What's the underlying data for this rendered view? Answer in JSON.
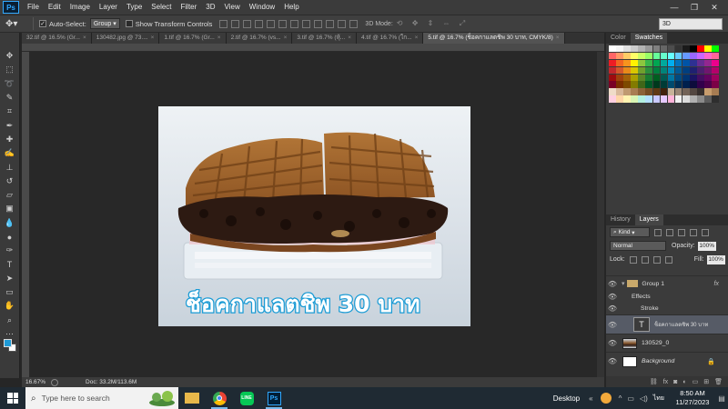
{
  "app": {
    "logo": "Ps",
    "menu": [
      "File",
      "Edit",
      "Image",
      "Layer",
      "Type",
      "Select",
      "Filter",
      "3D",
      "View",
      "Window",
      "Help"
    ],
    "window_controls": [
      "—",
      "❐",
      "✕"
    ]
  },
  "options_bar": {
    "auto_select_label": "Auto-Select:",
    "auto_select_value": "Group",
    "show_transform_label": "Show Transform Controls",
    "mode_3d_label": "3D Mode:",
    "workspace_value": "3D"
  },
  "tabs": [
    {
      "label": "32.tif @ 16.5% (Gr...",
      "active": false
    },
    {
      "label": "130482.jpg @ 73....",
      "active": false
    },
    {
      "label": "1.tif @ 16.7% (Gr...",
      "active": false
    },
    {
      "label": "2.tif @ 16.7% (vs...",
      "active": false
    },
    {
      "label": "3.tif @ 16.7% (หุ้...",
      "active": false
    },
    {
      "label": "4.tif @ 16.7% (ใก...",
      "active": false
    },
    {
      "label": "5.tif @ 16.7% (ช็อคกาแลตชิพ 30 บาท, CMYK/8)",
      "active": true
    }
  ],
  "canvas": {
    "caption": "ช็อคกาแลตชิพ 30 บาท"
  },
  "status": {
    "zoom": "16.67%",
    "doc": "Doc: 33.2M/113.6M"
  },
  "panels": {
    "top_tabs": [
      "Color",
      "Swatches"
    ],
    "top_active": "Swatches",
    "swatch_colors": [
      "#ffffff",
      "#f5f5f5",
      "#e0e0e0",
      "#cccccc",
      "#b3b3b3",
      "#999999",
      "#808080",
      "#666666",
      "#4d4d4d",
      "#333333",
      "#1a1a1a",
      "#000000",
      "#ff0000",
      "#ffff00",
      "#00ff00",
      "#ff6666",
      "#ff9966",
      "#ffcc66",
      "#ffff66",
      "#ccff66",
      "#99ff66",
      "#66ff99",
      "#66ffcc",
      "#66ffff",
      "#66ccff",
      "#6699ff",
      "#9966ff",
      "#cc66ff",
      "#ff66cc",
      "#ff6699",
      "#ee1c24",
      "#f26522",
      "#f7941d",
      "#fff200",
      "#8dc63f",
      "#39b54a",
      "#00a651",
      "#00a99d",
      "#00aeef",
      "#0072bc",
      "#0054a6",
      "#2e3192",
      "#662d91",
      "#92278f",
      "#ec008c",
      "#c1272d",
      "#d4572b",
      "#e88a1a",
      "#d9c600",
      "#6f9f2e",
      "#2b8f3c",
      "#007f3f",
      "#00847a",
      "#0089bc",
      "#005a96",
      "#003f7f",
      "#1f2170",
      "#4b1f6f",
      "#70166e",
      "#b5006b",
      "#9e0b0f",
      "#a0410d",
      "#a36209",
      "#aba000",
      "#598527",
      "#197b30",
      "#005e20",
      "#005952",
      "#0076a3",
      "#004a80",
      "#003471",
      "#1b1464",
      "#440e62",
      "#630460",
      "#9e005d",
      "#7a0026",
      "#7b2e00",
      "#7d4900",
      "#827b00",
      "#406618",
      "#005826",
      "#00391d",
      "#003b36",
      "#004a6e",
      "#002f56",
      "#00204d",
      "#0d0c3c",
      "#32004b",
      "#4b0049",
      "#7b0046",
      "#f0dcc8",
      "#d8b89a",
      "#c09a70",
      "#a87d52",
      "#8c6239",
      "#754c24",
      "#603913",
      "#42210b",
      "#c7b299",
      "#998675",
      "#736357",
      "#534741",
      "#362f2d",
      "#c69c6d",
      "#a67c52",
      "#ffcfe0",
      "#ffd5a6",
      "#fff3b0",
      "#d9f5b3",
      "#b3f0e0",
      "#b3e0ff",
      "#c9c9ff",
      "#e6c9ff",
      "#ffb3d9",
      "#f2f2f2",
      "#dcdcdc",
      "#b0b0b0",
      "#8a8a8a",
      "#5c5c5c",
      "#2e2e2e"
    ],
    "layers_tabs": [
      "History",
      "Layers"
    ],
    "layers_active": "Layers",
    "kind_label": "Kind",
    "blend_mode": "Normal",
    "opacity_label": "Opacity:",
    "opacity_value": "100%",
    "lock_label": "Lock:",
    "fill_label": "Fill:",
    "fill_value": "100%",
    "layers": [
      {
        "name": "Group 1",
        "type": "group",
        "fx": "fx"
      },
      {
        "name": "Effects",
        "type": "effects"
      },
      {
        "name": "Stroke",
        "type": "effect-item"
      },
      {
        "name": "ช็อคกาแลตชิพ 30 บาท",
        "type": "text",
        "selected": true
      },
      {
        "name": "130529_0",
        "type": "image"
      },
      {
        "name": "Background",
        "type": "background"
      }
    ]
  },
  "taskbar": {
    "search_placeholder": "Type here to search",
    "desktop_label": "Desktop",
    "lang": "ไทย",
    "time": "8:50 AM",
    "date": "11/27/2023"
  }
}
